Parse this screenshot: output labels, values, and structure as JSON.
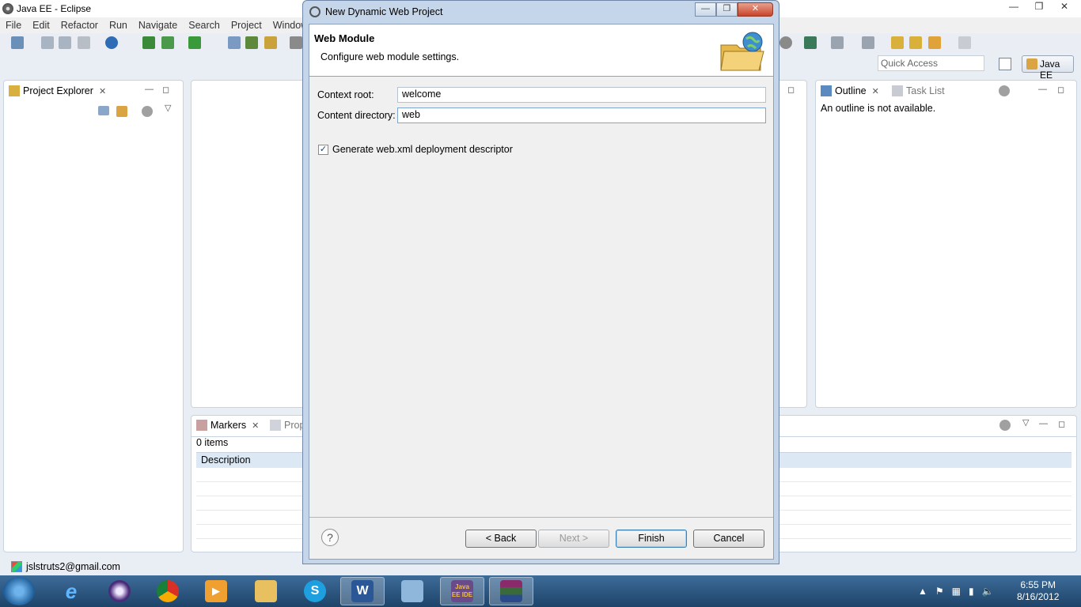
{
  "window": {
    "title": "Java EE - Eclipse"
  },
  "menu": [
    "File",
    "Edit",
    "Refactor",
    "Run",
    "Navigate",
    "Search",
    "Project",
    "Window"
  ],
  "quick_access": {
    "placeholder": "Quick Access"
  },
  "perspective": {
    "label": "Java EE"
  },
  "project_explorer": {
    "tab": "Project Explorer"
  },
  "outline": {
    "tab": "Outline",
    "message": "An outline is not available.",
    "tasklist_tab": "Task List"
  },
  "markers": {
    "tab": "Markers",
    "second_tab": "Prop",
    "count": "0 items",
    "column": "Description"
  },
  "status": {
    "account": "jslstruts2@gmail.com"
  },
  "dialog": {
    "title": "New Dynamic Web Project",
    "header_title": "Web Module",
    "header_subtitle": "Configure web module settings.",
    "context_root_label": "Context root:",
    "context_root_value": "welcome",
    "content_dir_label": "Content directory:",
    "content_dir_value": "web",
    "generate_xml_label": "Generate web.xml deployment descriptor",
    "generate_xml_checked": true,
    "help_label": "?",
    "back_label": "< Back",
    "next_label": "Next >",
    "finish_label": "Finish",
    "cancel_label": "Cancel"
  },
  "taskbar": {
    "apps": [
      "internet-explorer",
      "eclipse",
      "chrome",
      "media-player",
      "file-explorer",
      "skype",
      "word",
      "notepad",
      "java-ee-ide",
      "winrar"
    ],
    "ide_label": "Java EE IDE",
    "time": "6:55 PM",
    "date": "8/16/2012"
  }
}
